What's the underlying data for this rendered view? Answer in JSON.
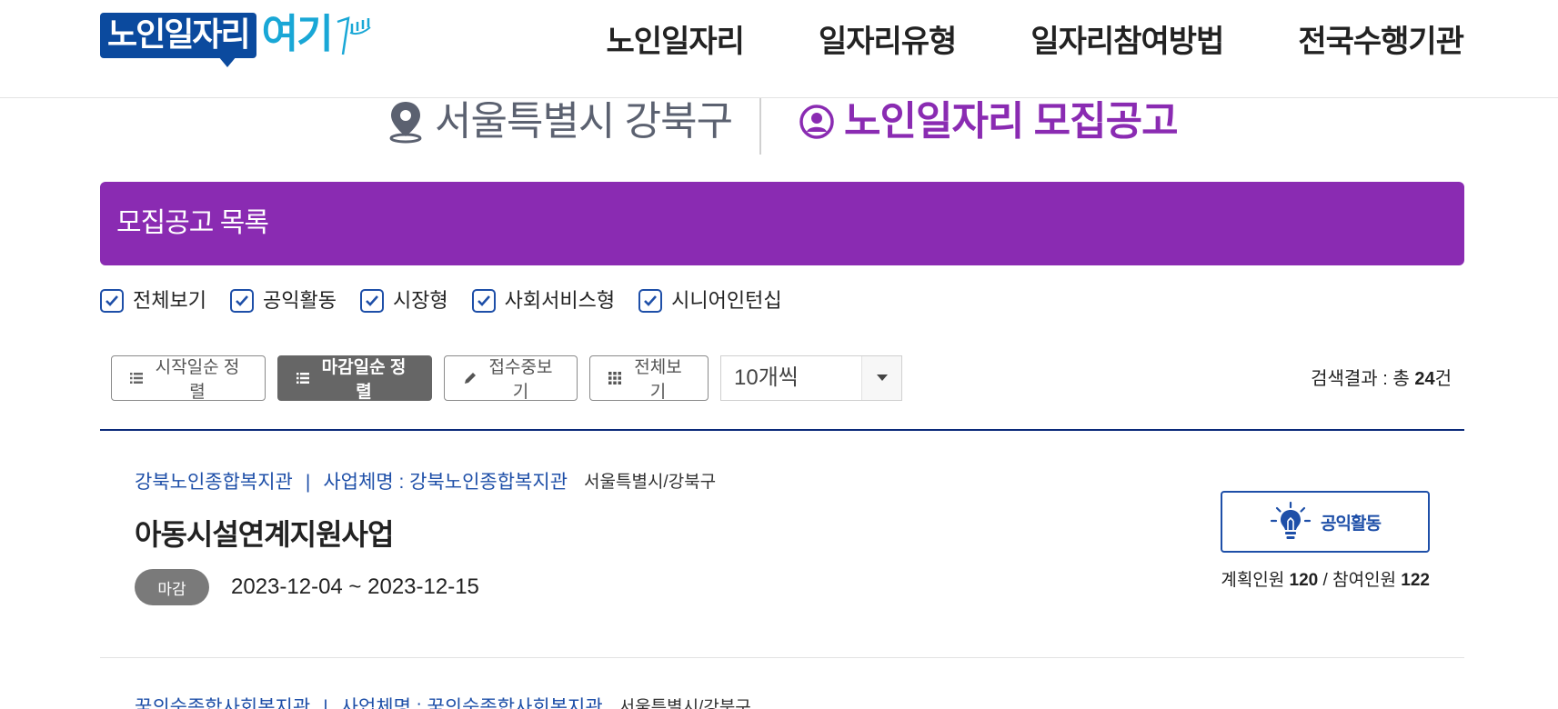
{
  "header": {
    "logo_main": "노인일자리",
    "logo_accent": "여기",
    "nav": [
      "노인일자리",
      "일자리유형",
      "일자리참여방법",
      "전국수행기관"
    ]
  },
  "location": {
    "region": "서울특별시 강북구",
    "page_title": "노인일자리 모집공고"
  },
  "banner": {
    "title": "모집공고 목록"
  },
  "filters": [
    {
      "label": "전체보기",
      "checked": true
    },
    {
      "label": "공익활동",
      "checked": true
    },
    {
      "label": "시장형",
      "checked": true
    },
    {
      "label": "사회서비스형",
      "checked": true
    },
    {
      "label": "시니어인턴십",
      "checked": true
    }
  ],
  "toolbar": {
    "sort_start": "시작일순 정렬",
    "sort_deadline": "마감일순 정렬",
    "view_open": "접수중보기",
    "view_all": "전체보기",
    "per_page": "10개씩"
  },
  "result": {
    "prefix": "검색결과 : 총 ",
    "count": "24",
    "suffix": "건"
  },
  "listings": [
    {
      "org": "강북노인종합복지관",
      "separator": "|",
      "business": "사업체명 : 강북노인종합복지관",
      "region": "서울특별시/강북구",
      "title": "아동시설연계지원사업",
      "status": "마감",
      "date_range": "2023-12-04 ~ 2023-12-15",
      "type": "공익활동",
      "planned_label": "계획인원",
      "planned": "120",
      "slash": "/",
      "participants_label": "참여인원",
      "participants": "122"
    },
    {
      "org": "꿈의숲종합사회복지관",
      "separator": "|",
      "business": "사업체명 : 꿈의숲종합사회복지관",
      "region": "서울특별시/강북구"
    }
  ],
  "colors": {
    "brand_blue": "#0b4a9e",
    "accent_purple": "#8a2bb2",
    "link_blue": "#1e4fa8"
  }
}
